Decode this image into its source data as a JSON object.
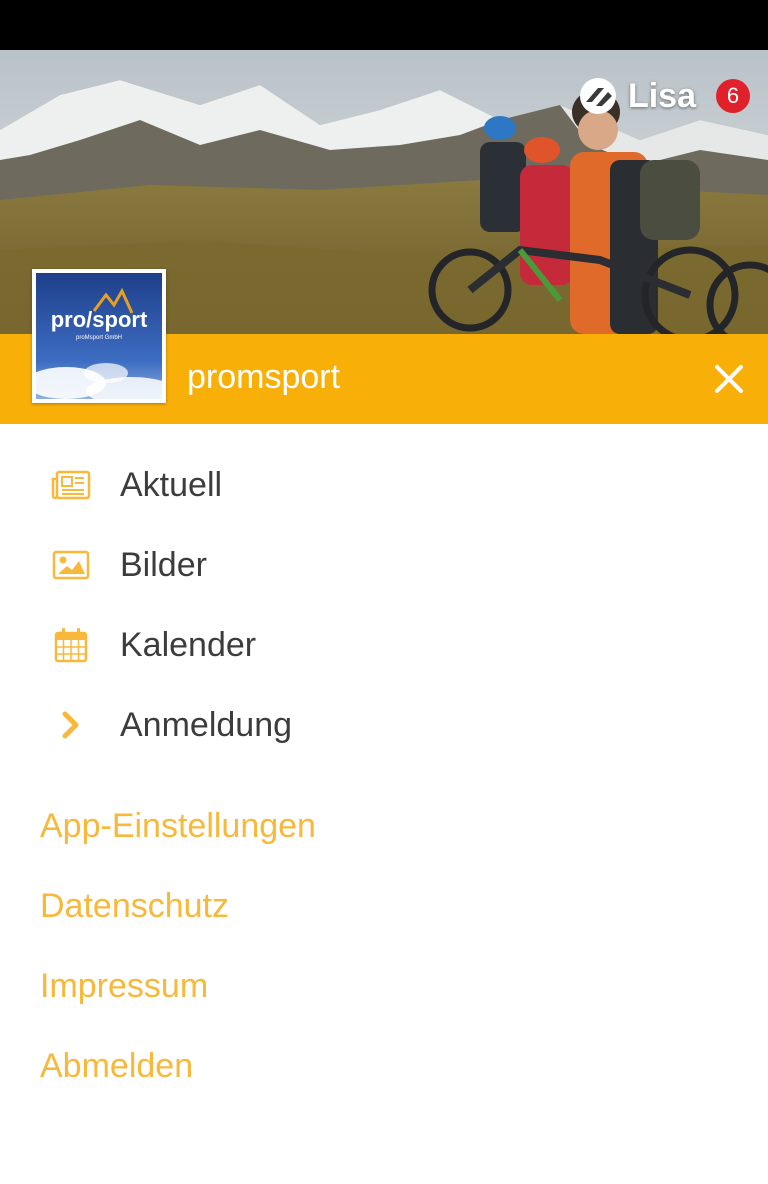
{
  "header": {
    "user_name": "Lisa",
    "notification_count": "6",
    "club_name": "promsport",
    "logo_text": "pro/sport",
    "logo_subtext": "proMsport GmbH"
  },
  "menu": {
    "items": [
      {
        "label": "Aktuell",
        "icon": "newspaper-icon"
      },
      {
        "label": "Bilder",
        "icon": "image-icon"
      },
      {
        "label": "Kalender",
        "icon": "calendar-icon"
      },
      {
        "label": "Anmeldung",
        "icon": "chevron-right-icon"
      }
    ]
  },
  "links": {
    "items": [
      {
        "label": "App-Einstellungen"
      },
      {
        "label": "Datenschutz"
      },
      {
        "label": "Impressum"
      },
      {
        "label": "Abmelden"
      }
    ]
  },
  "colors": {
    "accent": "#f8b009",
    "link": "#f8b83a",
    "badge": "#e0202a",
    "text": "#3c3c3c"
  }
}
